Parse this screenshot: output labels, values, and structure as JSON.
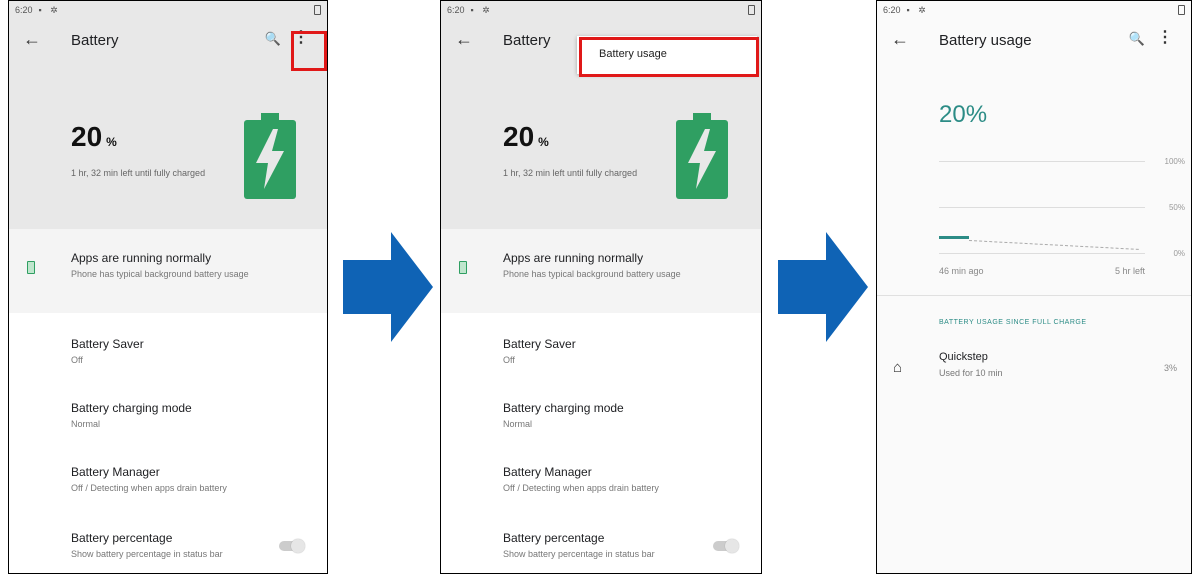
{
  "colors": {
    "accent": "#2c8c86",
    "battery_green": "#2f9f62",
    "highlight_red": "#e01818",
    "arrow_blue": "#0f63b5"
  },
  "status": {
    "time": "6:20",
    "icons": "▪ ✲"
  },
  "screen1": {
    "back_icon": "←",
    "title": "Battery",
    "search_icon": "🔍",
    "more_icon": "⋮",
    "level": "20",
    "level_unit": "%",
    "charge_info": "1 hr, 32 min left until fully charged",
    "card_title": "Apps are running normally",
    "card_sub": "Phone has typical background battery usage",
    "items": [
      {
        "title": "Battery Saver",
        "sub": "Off"
      },
      {
        "title": "Battery charging mode",
        "sub": "Normal"
      },
      {
        "title": "Battery Manager",
        "sub": "Off / Detecting when apps drain battery"
      },
      {
        "title": "Battery percentage",
        "sub": "Show battery percentage in status bar"
      }
    ]
  },
  "screen2": {
    "back_icon": "←",
    "title": "Battery",
    "popup_item": "Battery usage",
    "level": "20",
    "level_unit": "%",
    "charge_info": "1 hr, 32 min left until fully charged",
    "card_title": "Apps are running normally",
    "card_sub": "Phone has typical background battery usage",
    "items": [
      {
        "title": "Battery Saver",
        "sub": "Off"
      },
      {
        "title": "Battery charging mode",
        "sub": "Normal"
      },
      {
        "title": "Battery Manager",
        "sub": "Off / Detecting when apps drain battery"
      },
      {
        "title": "Battery percentage",
        "sub": "Show battery percentage in status bar"
      }
    ]
  },
  "screen3": {
    "back_icon": "←",
    "title": "Battery usage",
    "search_icon": "🔍",
    "more_icon": "⋮",
    "level": "20%",
    "grid_labels": [
      "100%",
      "50%",
      "0%"
    ],
    "time_left_label": "46 min ago",
    "time_right_label": "5 hr left",
    "section_title": "BATTERY USAGE SINCE FULL CHARGE",
    "app": {
      "icon": "⌂",
      "name": "Quickstep",
      "usage": "Used for 10 min",
      "percent": "3%"
    }
  }
}
